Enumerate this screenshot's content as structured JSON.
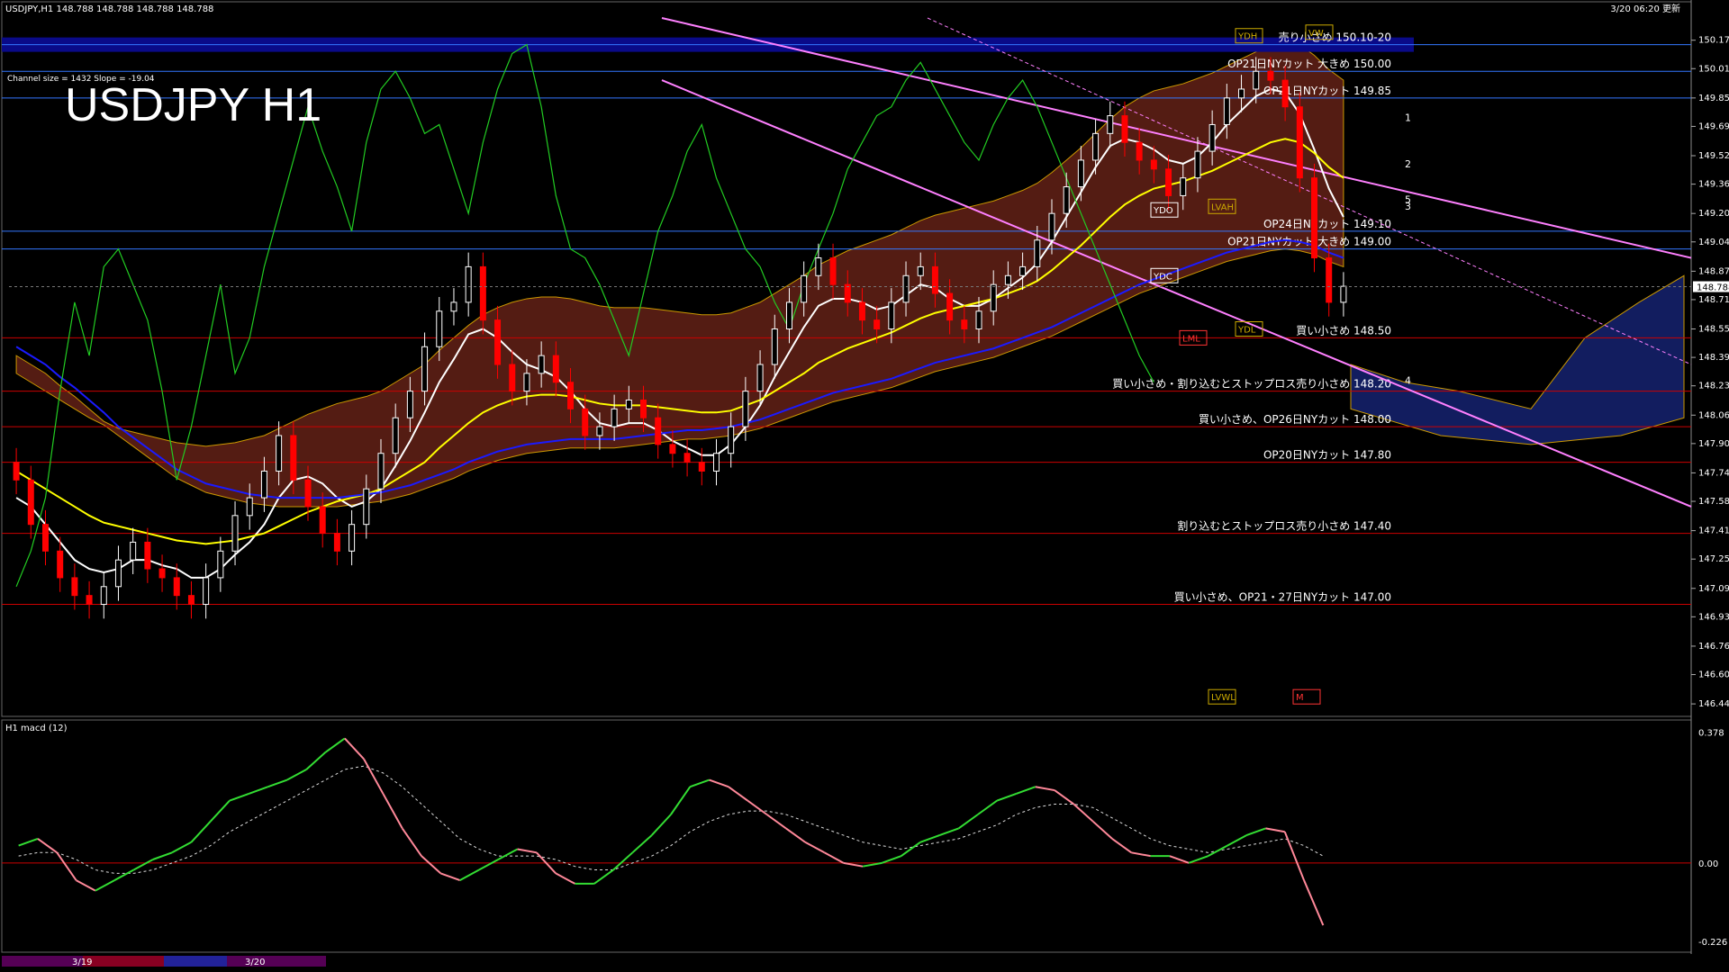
{
  "header": {
    "symbol_info": "USDJPY,H1  148.788 148.788 148.788 148.788",
    "timestamp": "3/20 06:20 更新",
    "channel_info": "Channel size = 1432 Slope = -19.04",
    "big_title": "USDJPY H1",
    "macd_title": "H1  macd (12)"
  },
  "colors": {
    "background": "#000000",
    "bull_candle": "#ffffff",
    "bear_candle": "#ff0000",
    "ma_white": "#ffffff",
    "ma_yellow": "#ffff00",
    "ma_blue": "#1a1aff",
    "chikou_green": "#22cc22",
    "channel_pink": "#ff80ff",
    "kumo_red": "#993322",
    "macd_up": "#33dd33",
    "macd_down": "#ff8899",
    "level_blue": "#3377ff",
    "level_red": "#cc0000"
  },
  "chart_data": [
    {
      "type": "candlestick",
      "title": "USDJPY H1",
      "y_axis_ticks": [
        "150.175",
        "150.015",
        "149.850",
        "149.690",
        "149.525",
        "149.365",
        "149.200",
        "149.040",
        "148.875",
        "148.715",
        "148.550",
        "148.390",
        "148.230",
        "148.065",
        "147.905",
        "147.740",
        "147.580",
        "147.415",
        "147.255",
        "147.090",
        "146.930",
        "146.765",
        "146.605",
        "146.440"
      ],
      "ylim": [
        146.4,
        150.3
      ],
      "current_price": "148.788",
      "close": [
        147.7,
        147.45,
        147.3,
        147.15,
        147.05,
        147.0,
        147.1,
        147.25,
        147.35,
        147.2,
        147.15,
        147.05,
        147.0,
        147.15,
        147.3,
        147.5,
        147.6,
        147.75,
        147.95,
        147.7,
        147.55,
        147.4,
        147.3,
        147.45,
        147.65,
        147.85,
        148.05,
        148.2,
        148.45,
        148.65,
        148.7,
        148.9,
        148.6,
        148.35,
        148.2,
        148.3,
        148.4,
        148.25,
        148.1,
        147.95,
        148.0,
        148.1,
        148.15,
        148.05,
        147.9,
        147.85,
        147.8,
        147.75,
        147.85,
        148.0,
        148.2,
        148.35,
        148.55,
        148.7,
        148.85,
        148.95,
        148.8,
        148.7,
        148.6,
        148.55,
        148.7,
        148.85,
        148.9,
        148.75,
        148.6,
        148.55,
        148.65,
        148.8,
        148.85,
        148.9,
        149.05,
        149.2,
        149.35,
        149.5,
        149.65,
        149.75,
        149.6,
        149.5,
        149.45,
        149.3,
        149.4,
        149.55,
        149.7,
        149.85,
        149.9,
        150.0,
        149.95,
        149.8,
        149.4,
        148.95,
        148.7,
        148.79
      ],
      "open": [
        147.8,
        147.7,
        147.45,
        147.3,
        147.15,
        147.05,
        147.0,
        147.1,
        147.25,
        147.35,
        147.2,
        147.15,
        147.05,
        147.0,
        147.15,
        147.3,
        147.5,
        147.6,
        147.75,
        147.95,
        147.7,
        147.55,
        147.4,
        147.3,
        147.45,
        147.65,
        147.85,
        148.05,
        148.2,
        148.45,
        148.65,
        148.7,
        148.9,
        148.6,
        148.35,
        148.2,
        148.3,
        148.4,
        148.25,
        148.1,
        147.95,
        148.0,
        148.1,
        148.15,
        148.05,
        147.9,
        147.85,
        147.8,
        147.75,
        147.85,
        148.0,
        148.2,
        148.35,
        148.55,
        148.7,
        148.85,
        148.95,
        148.8,
        148.7,
        148.6,
        148.55,
        148.7,
        148.85,
        148.9,
        148.75,
        148.6,
        148.55,
        148.65,
        148.8,
        148.85,
        148.9,
        149.05,
        149.2,
        149.35,
        149.5,
        149.65,
        149.75,
        149.6,
        149.5,
        149.45,
        149.3,
        149.4,
        149.55,
        149.7,
        149.85,
        149.9,
        150.0,
        149.95,
        149.8,
        149.4,
        148.95,
        148.7
      ],
      "lines": [
        {
          "key": "ma_white",
          "values": [
            147.6,
            147.55,
            147.45,
            147.35,
            147.25,
            147.2,
            147.18,
            147.2,
            147.25,
            147.25,
            147.22,
            147.2,
            147.15,
            147.15,
            147.2,
            147.28,
            147.35,
            147.45,
            147.6,
            147.7,
            147.72,
            147.68,
            147.6,
            147.55,
            147.58,
            147.65,
            147.78,
            147.92,
            148.08,
            148.25,
            148.38,
            148.52,
            148.55,
            148.5,
            148.42,
            148.35,
            148.32,
            148.28,
            148.2,
            148.1,
            148.02,
            148.0,
            148.02,
            148.02,
            147.98,
            147.92,
            147.88,
            147.84,
            147.84,
            147.9,
            148.0,
            148.12,
            148.28,
            148.42,
            148.56,
            148.68,
            148.72,
            148.72,
            148.7,
            148.66,
            148.68,
            148.74,
            148.8,
            148.78,
            148.72,
            148.68,
            148.68,
            148.72,
            148.78,
            148.84,
            148.92,
            149.04,
            149.18,
            149.32,
            149.46,
            149.58,
            149.62,
            149.6,
            149.56,
            149.5,
            149.48,
            149.52,
            149.6,
            149.7,
            149.78,
            149.86,
            149.9,
            149.88,
            149.76,
            149.56,
            149.34,
            149.18
          ]
        },
        {
          "key": "ma_yellow",
          "values": [
            147.75,
            147.7,
            147.65,
            147.6,
            147.55,
            147.5,
            147.46,
            147.44,
            147.42,
            147.4,
            147.38,
            147.36,
            147.35,
            147.34,
            147.35,
            147.36,
            147.38,
            147.4,
            147.44,
            147.48,
            147.52,
            147.55,
            147.58,
            147.6,
            147.62,
            147.65,
            147.7,
            147.75,
            147.8,
            147.88,
            147.95,
            148.02,
            148.08,
            148.12,
            148.15,
            148.17,
            148.18,
            148.18,
            148.17,
            148.15,
            148.13,
            148.12,
            148.12,
            148.12,
            148.11,
            148.1,
            148.09,
            148.08,
            148.08,
            148.09,
            148.12,
            148.15,
            148.2,
            148.25,
            148.3,
            148.36,
            148.4,
            148.44,
            148.47,
            148.5,
            148.53,
            148.57,
            148.61,
            148.64,
            148.66,
            148.68,
            148.7,
            148.72,
            148.75,
            148.78,
            148.82,
            148.88,
            148.95,
            149.02,
            149.1,
            149.18,
            149.25,
            149.3,
            149.34,
            149.36,
            149.38,
            149.41,
            149.44,
            149.48,
            149.52,
            149.56,
            149.6,
            149.62,
            149.6,
            149.54,
            149.46,
            149.4
          ]
        },
        {
          "key": "ma_blue",
          "values": [
            148.45,
            148.4,
            148.35,
            148.28,
            148.22,
            148.15,
            148.08,
            148.0,
            147.94,
            147.88,
            147.82,
            147.76,
            147.72,
            147.68,
            147.66,
            147.64,
            147.62,
            147.61,
            147.6,
            147.6,
            147.6,
            147.6,
            147.6,
            147.61,
            147.62,
            147.63,
            147.65,
            147.67,
            147.7,
            147.73,
            147.76,
            147.8,
            147.83,
            147.86,
            147.88,
            147.9,
            147.91,
            147.92,
            147.93,
            147.93,
            147.93,
            147.93,
            147.94,
            147.95,
            147.96,
            147.97,
            147.98,
            147.98,
            147.99,
            148.0,
            148.02,
            148.04,
            148.07,
            148.1,
            148.13,
            148.16,
            148.19,
            148.21,
            148.23,
            148.25,
            148.27,
            148.3,
            148.33,
            148.36,
            148.38,
            148.4,
            148.42,
            148.44,
            148.47,
            148.5,
            148.53,
            148.56,
            148.6,
            148.64,
            148.68,
            148.72,
            148.76,
            148.8,
            148.83,
            148.86,
            148.89,
            148.92,
            148.95,
            148.98,
            149.0,
            149.02,
            149.04,
            149.05,
            149.04,
            149.02,
            148.98,
            148.95
          ]
        },
        {
          "key": "chikou_green",
          "values": [
            147.1,
            147.3,
            147.6,
            148.2,
            148.7,
            148.4,
            148.9,
            149.0,
            148.8,
            148.6,
            148.2,
            147.7,
            148.0,
            148.4,
            148.8,
            148.3,
            148.5,
            148.9,
            149.2,
            149.5,
            149.8,
            149.55,
            149.35,
            149.1,
            149.6,
            149.9,
            150.0,
            149.85,
            149.65,
            149.7,
            149.45,
            149.2,
            149.6,
            149.9,
            150.1,
            150.15,
            149.8,
            149.3,
            149.0,
            148.95,
            148.8,
            148.6,
            148.4,
            148.75,
            149.1,
            149.3,
            149.55,
            149.7,
            149.4,
            149.2,
            149.0,
            148.9,
            148.7,
            148.55,
            148.8,
            149.0,
            149.2,
            149.45,
            149.6,
            149.75,
            149.8,
            149.95,
            150.05,
            149.9,
            149.75,
            149.6,
            149.5,
            149.7,
            149.85,
            149.95,
            149.8,
            149.6,
            149.4,
            149.2,
            149.0,
            148.8,
            148.6,
            148.4,
            148.25
          ]
        }
      ],
      "levels": [
        {
          "price": 150.15,
          "color": "blue",
          "label": "売り小さめ 150.10-20",
          "highlight": true
        },
        {
          "price": 150.0,
          "color": "blue",
          "label": "OP21日NYカット 大きめ 150.00"
        },
        {
          "price": 149.85,
          "color": "blue",
          "label": "OP21日NYカット 149.85"
        },
        {
          "price": 149.1,
          "color": "blue",
          "label": "OP24日NYカット 149.10"
        },
        {
          "price": 149.0,
          "color": "blue",
          "label": "OP21日NYカット 大きめ 149.00"
        },
        {
          "price": 148.5,
          "color": "red",
          "label": "買い小さめ 148.50"
        },
        {
          "price": 148.2,
          "color": "red",
          "label": "買い小さめ・割り込むとストップロス売り小さめ 148.20"
        },
        {
          "price": 148.0,
          "color": "red",
          "label": "買い小さめ、OP26日NYカット 148.00"
        },
        {
          "price": 147.8,
          "color": "red",
          "label": "OP20日NYカット 147.80"
        },
        {
          "price": 147.4,
          "color": "red",
          "label": "割り込むとストップロス売り小さめ 147.40"
        },
        {
          "price": 147.0,
          "color": "red",
          "label": "買い小さめ、OP21・27日NYカット 147.00"
        }
      ],
      "box_labels": [
        "YDH",
        "YDO",
        "LVAH",
        "YDC",
        "YDL",
        "LML",
        "VW",
        "LVWL",
        "M"
      ],
      "channel_numbers": [
        "1",
        "2",
        "5",
        "3",
        "4"
      ]
    },
    {
      "type": "line",
      "title": "H1  macd (12)",
      "y_axis_ticks": [
        "0.378",
        "0.00",
        "-0.226"
      ],
      "ylim": [
        -0.25,
        0.4
      ],
      "zero_line": 0.0,
      "macd": [
        0.05,
        0.07,
        0.03,
        -0.05,
        -0.08,
        -0.05,
        -0.02,
        0.01,
        0.03,
        0.06,
        0.12,
        0.18,
        0.2,
        0.22,
        0.24,
        0.27,
        0.32,
        0.36,
        0.3,
        0.2,
        0.1,
        0.02,
        -0.03,
        -0.05,
        -0.02,
        0.01,
        0.04,
        0.03,
        -0.03,
        -0.06,
        -0.06,
        -0.02,
        0.03,
        0.08,
        0.14,
        0.22,
        0.24,
        0.22,
        0.18,
        0.14,
        0.1,
        0.06,
        0.03,
        0.0,
        -0.01,
        0.0,
        0.02,
        0.06,
        0.08,
        0.1,
        0.14,
        0.18,
        0.2,
        0.22,
        0.21,
        0.17,
        0.12,
        0.07,
        0.03,
        0.02,
        0.02,
        0.0,
        0.02,
        0.05,
        0.08,
        0.1,
        0.09,
        -0.05,
        -0.18
      ],
      "signal": [
        0.02,
        0.03,
        0.03,
        0.01,
        -0.02,
        -0.03,
        -0.03,
        -0.02,
        0.0,
        0.02,
        0.05,
        0.09,
        0.12,
        0.15,
        0.18,
        0.21,
        0.24,
        0.27,
        0.28,
        0.26,
        0.22,
        0.17,
        0.12,
        0.07,
        0.04,
        0.02,
        0.02,
        0.02,
        0.01,
        -0.01,
        -0.02,
        -0.02,
        0.0,
        0.02,
        0.05,
        0.09,
        0.12,
        0.14,
        0.15,
        0.15,
        0.14,
        0.12,
        0.1,
        0.08,
        0.06,
        0.05,
        0.04,
        0.05,
        0.06,
        0.07,
        0.09,
        0.11,
        0.14,
        0.16,
        0.17,
        0.17,
        0.16,
        0.13,
        0.1,
        0.07,
        0.05,
        0.04,
        0.03,
        0.04,
        0.05,
        0.06,
        0.07,
        0.05,
        0.02
      ],
      "date_labels": [
        "3/19",
        "3/20"
      ]
    }
  ]
}
